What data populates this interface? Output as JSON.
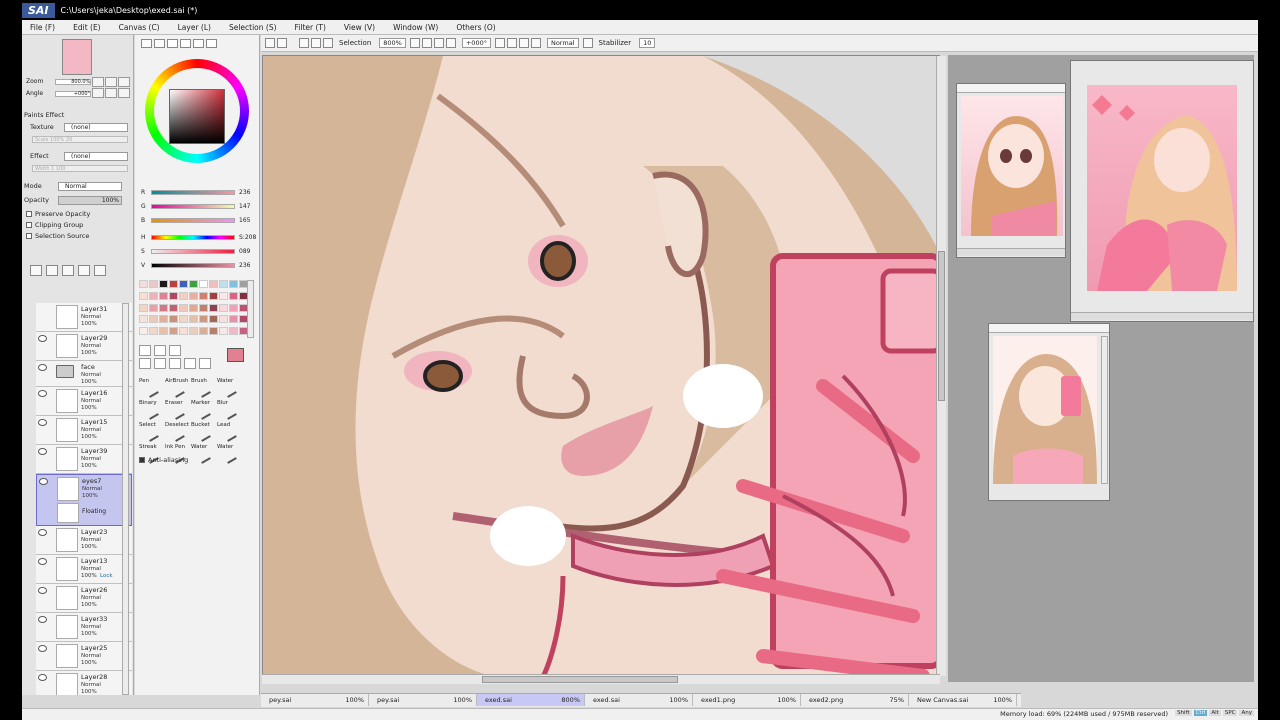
{
  "window": {
    "app_logo": "SAI",
    "title_path": "C:\\Users\\jeka\\Desktop\\exed.sai (*)"
  },
  "menu": [
    "File (F)",
    "Edit (E)",
    "Canvas (C)",
    "Layer (L)",
    "Selection (S)",
    "Filter (T)",
    "View (V)",
    "Window (W)",
    "Others (O)"
  ],
  "navigator": {
    "zoom_label": "Zoom",
    "zoom_value": "800.0%",
    "angle_label": "Angle",
    "angle_value": "+000°"
  },
  "paper_effect": {
    "header": "Paints Effect",
    "texture_label": "Texture",
    "texture_value": "(none)",
    "scale_label": "Scale",
    "scale_value": "100%",
    "strength1": "20",
    "effect_label": "Effect",
    "effect_value": "(none)",
    "width_label": "Width",
    "width_value": "1",
    "strength2": "100"
  },
  "blending": {
    "mode_label": "Mode",
    "mode_value": "Normal",
    "opacity_label": "Opacity",
    "opacity_value": "100%",
    "preserve_opacity": "Preserve Opacity",
    "clipping_group": "Clipping Group",
    "selection_source": "Selection Source"
  },
  "layers": [
    {
      "name": "Layer31",
      "mode": "Normal",
      "opacity": "100%",
      "type": "layer",
      "visible": false
    },
    {
      "name": "Layer29",
      "mode": "Normal",
      "opacity": "100%",
      "type": "layer",
      "visible": true
    },
    {
      "name": "face",
      "mode": "Normal",
      "opacity": "100%",
      "type": "folder",
      "visible": true
    },
    {
      "name": "Layer16",
      "mode": "Normal",
      "opacity": "100%",
      "type": "layer",
      "visible": true
    },
    {
      "name": "Layer15",
      "mode": "Normal",
      "opacity": "100%",
      "type": "layer",
      "visible": true
    },
    {
      "name": "Layer39",
      "mode": "Normal",
      "opacity": "100%",
      "type": "layer",
      "visible": true
    },
    {
      "name": "eyes7",
      "mode": "Normal",
      "opacity": "100%",
      "type": "selected",
      "visible": true,
      "floating": "Floating"
    },
    {
      "name": "Layer23",
      "mode": "Normal",
      "opacity": "100%",
      "type": "layer",
      "visible": true
    },
    {
      "name": "Layer13",
      "mode": "Normal",
      "opacity": "100%",
      "type": "layer",
      "visible": true,
      "lock": "Lock"
    },
    {
      "name": "Layer26",
      "mode": "Normal",
      "opacity": "100%",
      "type": "layer",
      "visible": true
    },
    {
      "name": "Layer33",
      "mode": "Normal",
      "opacity": "100%",
      "type": "layer",
      "visible": true
    },
    {
      "name": "Layer25",
      "mode": "Normal",
      "opacity": "100%",
      "type": "layer",
      "visible": true
    },
    {
      "name": "Layer28",
      "mode": "Normal",
      "opacity": "100%",
      "type": "layer",
      "visible": true
    }
  ],
  "color": {
    "r_label": "R",
    "r": "236",
    "g_label": "G",
    "g": "147",
    "b_label": "B",
    "b": "165",
    "h_label": "H",
    "h": "S:208",
    "s_label": "S",
    "s": "089",
    "v_label": "V",
    "v": "236",
    "current": "#ec93a5"
  },
  "brushes": [
    {
      "label": "Pen"
    },
    {
      "label": "AirBrush"
    },
    {
      "label": "Brush"
    },
    {
      "label": "Water"
    },
    {
      "label": "Binary"
    },
    {
      "label": "Eraser"
    },
    {
      "label": "Marker"
    },
    {
      "label": "Blur"
    },
    {
      "label": "Select"
    },
    {
      "label": "Deselect"
    },
    {
      "label": "Bucket"
    },
    {
      "label": "Lead"
    },
    {
      "label": "Streak"
    },
    {
      "label": "Ink Pen"
    },
    {
      "label": "Water"
    },
    {
      "label": "Water"
    }
  ],
  "anti_aliasing": "Anti-aliasing",
  "toolbar": {
    "selection_label": "Selection",
    "zoom": "800%",
    "angle": "+000°",
    "blend": "Normal",
    "stabilizer_label": "Stabilizer",
    "stabilizer_value": "10"
  },
  "file_tabs": [
    {
      "name": "pey.sai",
      "zoom": "100%",
      "active": false
    },
    {
      "name": "pey.sai",
      "zoom": "100%",
      "active": false
    },
    {
      "name": "exed.sai",
      "zoom": "800%",
      "active": true
    },
    {
      "name": "exed.sai",
      "zoom": "100%",
      "active": false
    },
    {
      "name": "exed1.png",
      "zoom": "100%",
      "active": false
    },
    {
      "name": "exed2.png",
      "zoom": "75%",
      "active": false
    },
    {
      "name": "New Canvas.sai",
      "zoom": "100%",
      "active": false
    }
  ],
  "status": {
    "memory": "Memory load: 69% (224MB used / 975MB reserved)",
    "keys": [
      "Shift",
      "Ctrl",
      "Alt",
      "SPC",
      "Any"
    ]
  }
}
